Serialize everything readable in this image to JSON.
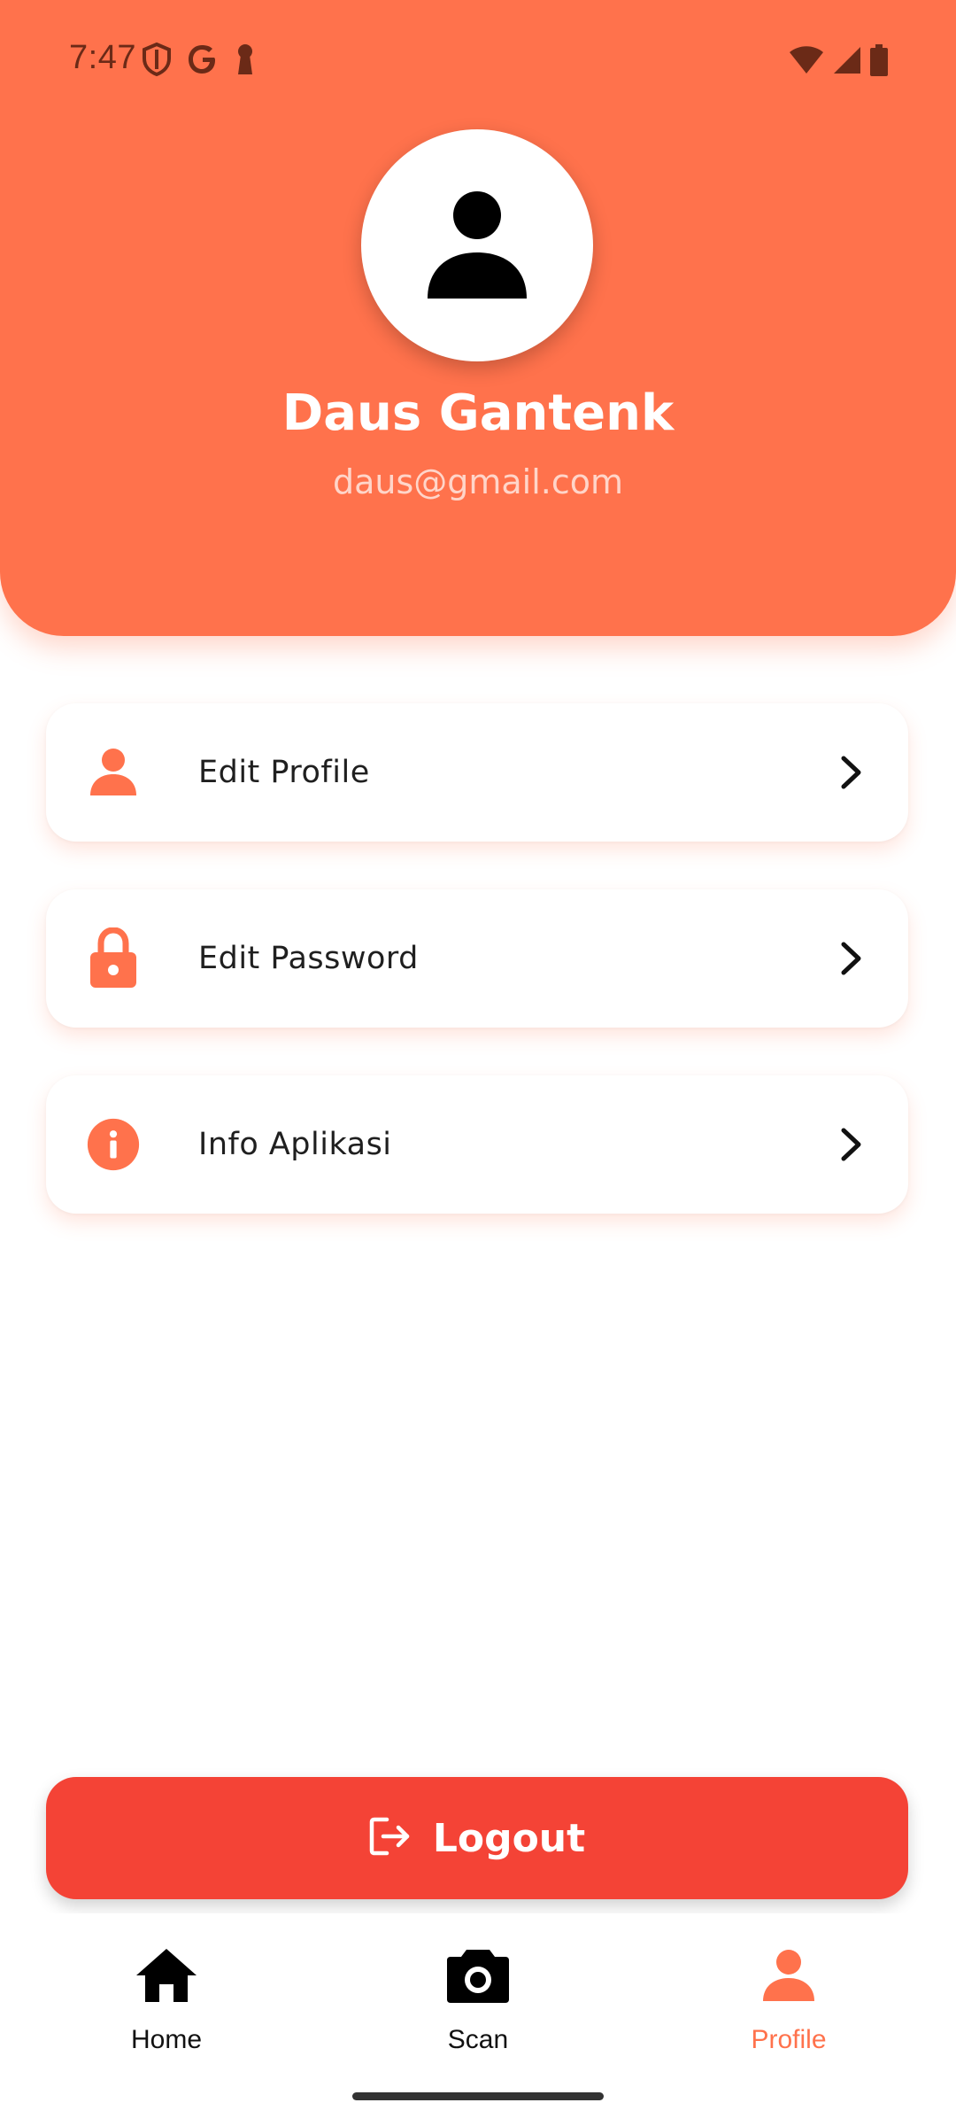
{
  "status_bar": {
    "time": "7:47",
    "left_icons": [
      "shield-icon",
      "google-icon",
      "keyhole-icon"
    ],
    "right_icons": [
      "wifi-icon",
      "signal-icon",
      "battery-icon"
    ]
  },
  "profile": {
    "name": "Daus Gantenk",
    "email": "daus@gmail.com",
    "avatar_icon": "person-icon"
  },
  "menu": {
    "items": [
      {
        "label": "Edit Profile",
        "icon": "person-icon"
      },
      {
        "label": "Edit Password",
        "icon": "lock-icon"
      },
      {
        "label": "Info Aplikasi",
        "icon": "info-icon"
      }
    ]
  },
  "logout": {
    "label": "Logout",
    "icon": "logout-icon",
    "color": "#F44336"
  },
  "bottom_nav": {
    "items": [
      {
        "label": "Home",
        "icon": "home-icon",
        "active": false
      },
      {
        "label": "Scan",
        "icon": "camera-icon",
        "active": false
      },
      {
        "label": "Profile",
        "icon": "person-icon",
        "active": true
      }
    ]
  },
  "colors": {
    "accent": "#FF724C",
    "danger": "#F44336",
    "text": "#1F1F1F"
  }
}
